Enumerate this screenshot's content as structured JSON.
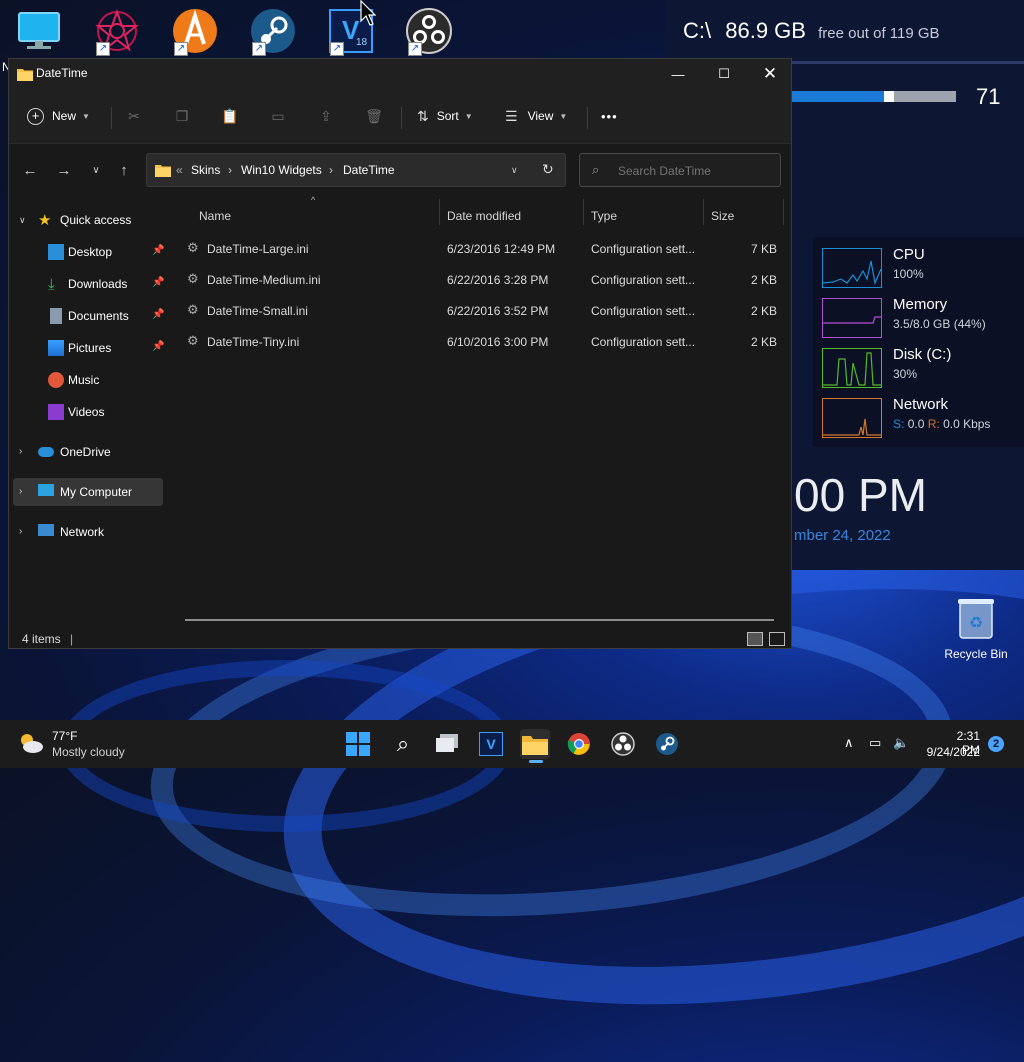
{
  "desktop": {
    "icons": [
      {
        "name": "monitor-icon"
      },
      {
        "name": "rainmeter-icon"
      },
      {
        "name": "aimp-icon"
      },
      {
        "name": "steam-icon"
      },
      {
        "name": "vegas-icon",
        "label": "V",
        "sub": "18"
      },
      {
        "name": "obs-icon"
      }
    ],
    "recycle_bin": "Recycle Bin",
    "partial_letter": "N"
  },
  "widgets": {
    "disk": {
      "drive": "C:\\",
      "free": "86.9 GB",
      "sub": "free out of 119 GB"
    },
    "meter": {
      "value": "71",
      "fill_fraction": 0.56
    },
    "perf": [
      {
        "name": "CPU",
        "value": "100%",
        "color": "#1b8fd6"
      },
      {
        "name": "Memory",
        "value": "3.5/8.0 GB (44%)",
        "color": "#b04fd0"
      },
      {
        "name": "Disk (C:)",
        "value": "30%",
        "color": "#55b82a"
      },
      {
        "name": "Network",
        "value_s": "S:",
        "value_s_num": "0.0",
        "value_r": "R:",
        "value_r_num": "0.0 Kbps",
        "color": "#d3772a"
      }
    ],
    "clock": {
      "time": "00 PM",
      "date": "mber 24, 2022"
    }
  },
  "explorer": {
    "title": "DateTime",
    "toolbar": {
      "new": "New",
      "sort": "Sort",
      "view": "View",
      "more": "•••"
    },
    "breadcrumb": {
      "lead": "«",
      "items": [
        "Skins",
        "Win10 Widgets",
        "DateTime"
      ]
    },
    "search_placeholder": "Search DateTime",
    "nav": {
      "quick_access": "Quick access",
      "items": [
        "Desktop",
        "Downloads",
        "Documents",
        "Pictures",
        "Music",
        "Videos"
      ],
      "onedrive": "OneDrive",
      "mycomputer": "My Computer",
      "network": "Network"
    },
    "columns": {
      "name": "Name",
      "modified": "Date modified",
      "type": "Type",
      "size": "Size"
    },
    "files": [
      {
        "name": "DateTime-Large.ini",
        "modified": "6/23/2016 12:49 PM",
        "type": "Configuration sett...",
        "size": "7 KB"
      },
      {
        "name": "DateTime-Medium.ini",
        "modified": "6/22/2016 3:28 PM",
        "type": "Configuration sett...",
        "size": "2 KB"
      },
      {
        "name": "DateTime-Small.ini",
        "modified": "6/22/2016 3:52 PM",
        "type": "Configuration sett...",
        "size": "2 KB"
      },
      {
        "name": "DateTime-Tiny.ini",
        "modified": "6/10/2016 3:00 PM",
        "type": "Configuration sett...",
        "size": "2 KB"
      }
    ],
    "status": "4 items"
  },
  "taskbar": {
    "weather_temp": "77°F",
    "weather_desc": "Mostly cloudy",
    "time": "2:31 PM",
    "date": "9/24/2022",
    "notifications": "2"
  }
}
